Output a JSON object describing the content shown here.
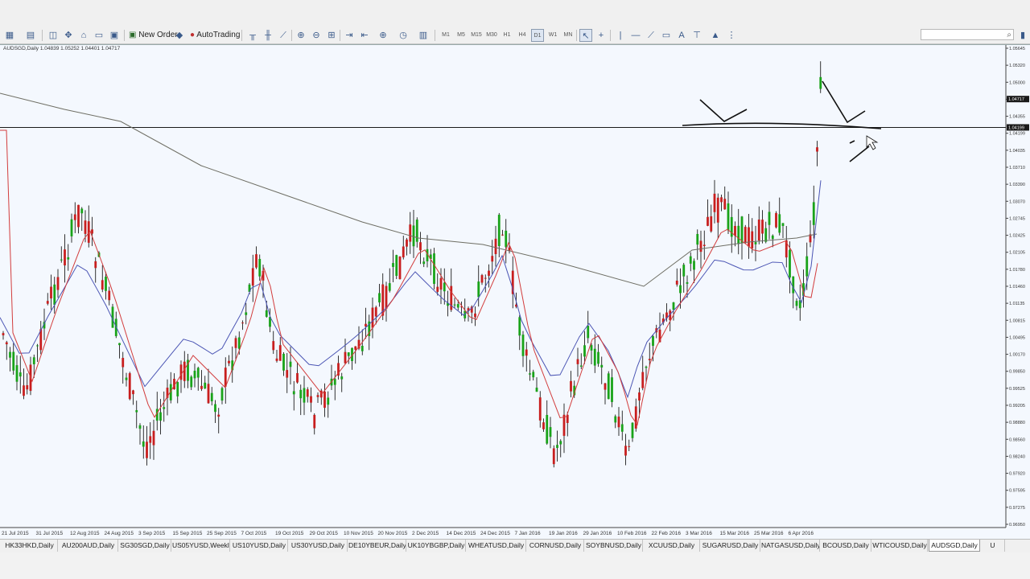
{
  "toolbar": {
    "new_order_label": "New Order",
    "autotrading_label": "AutoTrading",
    "timeframes": [
      "M1",
      "M5",
      "M15",
      "M30",
      "H1",
      "H4",
      "D1",
      "W1",
      "MN"
    ],
    "active_timeframe": "D1",
    "search_placeholder": ""
  },
  "chart": {
    "symbol_info": "AUDSGD,Daily  1.04839 1.05252 1.04401 1.04717",
    "bg_color": "#f4f8fe",
    "bull_color": "#19a319",
    "bear_color": "#c81e1e",
    "ma_fast_color": "#d23c3c",
    "ma_mid_color": "#4b55b4",
    "ma_slow_color": "#6e6e64",
    "horizontal_line_price": 1.04199,
    "current_price": 1.04717,
    "price_labels": [
      "1.05645",
      "1.05320",
      "1.05000",
      "1.04717",
      "1.04355",
      "1.04199",
      "1.04035",
      "1.03710",
      "1.03390",
      "1.03070",
      "1.02745",
      "1.02425",
      "1.02105",
      "1.01780",
      "1.01460",
      "1.01135",
      "1.00815",
      "1.00495",
      "1.00170",
      "0.99850",
      "0.99525",
      "0.99205",
      "0.98880",
      "0.98560",
      "0.98240",
      "0.97920",
      "0.97595",
      "0.97275",
      "0.96950"
    ],
    "date_labels": [
      "21 Jul 2015",
      "31 Jul 2015",
      "12 Aug 2015",
      "24 Aug 2015",
      "3 Sep 2015",
      "15 Sep 2015",
      "25 Sep 2015",
      "7 Oct 2015",
      "19 Oct 2015",
      "29 Oct 2015",
      "10 Nov 2015",
      "20 Nov 2015",
      "2 Dec 2015",
      "14 Dec 2015",
      "24 Dec 2015",
      "7 Jan 2016",
      "19 Jan 2016",
      "29 Jan 2016",
      "10 Feb 2016",
      "22 Feb 2016",
      "3 Mar 2016",
      "15 Mar 2016",
      "25 Mar 2016",
      "6 Apr 2016"
    ]
  },
  "tabs": [
    "HK33HKD,Daily",
    "AU200AUD,Daily",
    "SG30SGD,Daily",
    "US05YUSD,Weekly",
    "US10YUSD,Daily",
    "US30YUSD,Daily",
    "DE10YBEUR,Daily",
    "UK10YBGBP,Daily",
    "WHEATUSD,Daily",
    "CORNUSD,Daily",
    "SOYBNUSD,Daily",
    "XCUUSD,Daily",
    "SUGARUSD,Daily",
    "NATGASUSD,Daily",
    "BCOUSD,Daily",
    "WTICOUSD,Daily",
    "AUDSGD,Daily",
    "U"
  ],
  "active_tab": "AUDSGD,Daily"
}
